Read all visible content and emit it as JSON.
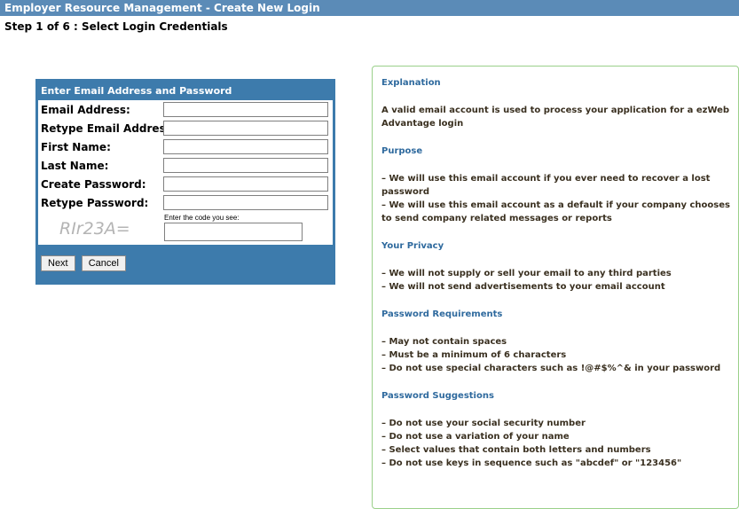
{
  "header": {
    "title": "Employer Resource Management  -  Create New Login",
    "step": "Step 1 of 6 : Select Login Credentials"
  },
  "form": {
    "heading": "Enter Email Address and Password",
    "fields": [
      {
        "label": "Email Address:",
        "value": ""
      },
      {
        "label": "Retype Email Address:",
        "value": ""
      },
      {
        "label": "First Name:",
        "value": ""
      },
      {
        "label": "Last Name:",
        "value": ""
      },
      {
        "label": "Create Password:",
        "value": ""
      },
      {
        "label": "Retype Password:",
        "value": ""
      }
    ],
    "captcha_text": "RIr23A=",
    "captcha_prompt": "Enter the code you see:",
    "next_label": "Next",
    "cancel_label": "Cancel"
  },
  "explanation": {
    "title": "Explanation",
    "text": "A valid email account is used to process your application for a ezWeb Advantage login",
    "purpose_title": "Purpose",
    "purpose": [
      "– We will use this email account if you ever need to recover a lost password",
      "– We will use this email account as a default if your company chooses to send company related messages or reports"
    ],
    "privacy_title": "Your Privacy",
    "privacy": [
      "– We will not supply or sell your email to any third parties",
      "– We will not send advertisements to your email account"
    ],
    "req_title": "Password Requirements",
    "requirements": [
      "– May not contain spaces",
      "– Must be a minimum of 6 characters",
      "– Do not use special characters such as !@#$%^& in your password"
    ],
    "sugg_title": "Password Suggestions",
    "suggestions": [
      "– Do not use your social security number",
      "– Do not use a variation of your name",
      "– Select values that contain both letters and numbers",
      "– Do not use keys in sequence such as \"abcdef\" or \"123456\""
    ]
  },
  "colors": {
    "topbar": "#5b8bb7",
    "form_panel": "#3d7bac",
    "section_title": "#2f6a9e",
    "explain_border": "#9ad08a"
  }
}
